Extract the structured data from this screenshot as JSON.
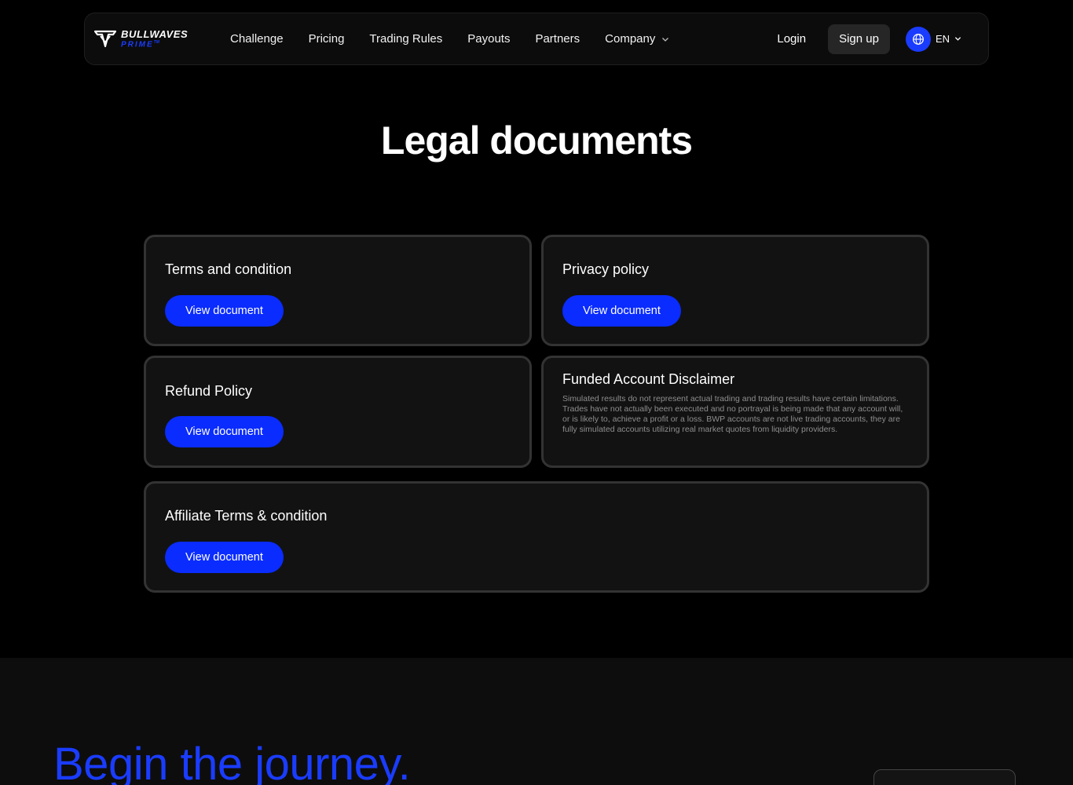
{
  "brand": {
    "name_top": "BULLWAVES",
    "name_bottom": "PRIME",
    "trademark": "TM",
    "accent_color": "#1a3cff"
  },
  "nav": {
    "links": [
      "Challenge",
      "Pricing",
      "Trading Rules",
      "Payouts",
      "Partners"
    ],
    "company_label": "Company",
    "login_label": "Login",
    "signup_label": "Sign up",
    "language": "EN"
  },
  "page": {
    "title": "Legal documents"
  },
  "cards": {
    "terms": {
      "title": "Terms and condition",
      "button": "View document"
    },
    "privacy": {
      "title": "Privacy policy",
      "button": "View document"
    },
    "refund": {
      "title": "Refund Policy",
      "button": "View document"
    },
    "disclaimer": {
      "title": "Funded Account Disclaimer",
      "text": "Simulated results do not represent actual trading and trading results have certain limitations. Trades have not actually been executed and no portrayal is being made that any account will, or is likely to, achieve a profit or a loss. BWP accounts are not live trading accounts, they are fully simulated accounts utilizing real market quotes from liquidity providers."
    },
    "affiliate": {
      "title": "Affiliate Terms & condition",
      "button": "View document"
    }
  },
  "footer": {
    "headline": "Begin the journey."
  },
  "icons": {
    "logo": "bull-shield-icon",
    "globe": "globe-icon",
    "chevron": "chevron-down-icon"
  }
}
